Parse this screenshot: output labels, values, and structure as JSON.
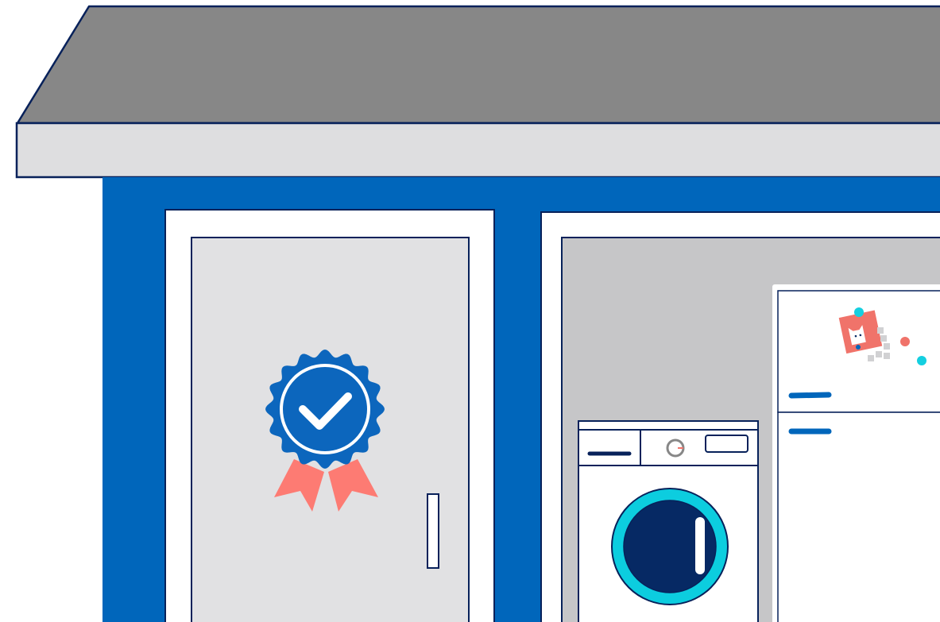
{
  "scene": {
    "subject": "house-storefront-with-appliances",
    "colors": {
      "roof_top": "#878787",
      "roof_front": "#dedee0",
      "wall": "#0066bb",
      "outline": "#07215a",
      "frame": "#ffffff",
      "door_panel": "#e1e1e3",
      "window_interior": "#c6c6c8",
      "badge": "#0c66bd",
      "ribbon": "#fd7b73",
      "drum_ring": "#0ccddf",
      "drum_glass": "#062964",
      "accent_red": "#f0736a",
      "accent_cyan": "#14cfe0",
      "tile_grey": "#d1d1d3"
    },
    "icons": {
      "badge": "checkmark-award-icon",
      "washer_knob": "dial-knob-icon",
      "magnet": "cat-photo-magnet-icon"
    }
  }
}
